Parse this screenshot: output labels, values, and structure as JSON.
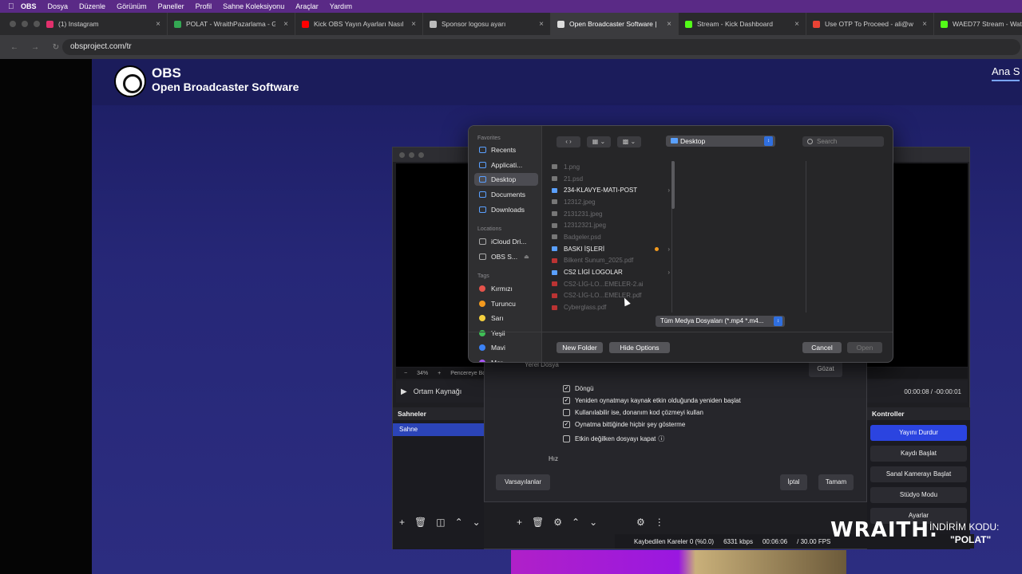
{
  "menubar": {
    "app": "OBS",
    "items": [
      "Dosya",
      "Düzenle",
      "Görünüm",
      "Paneller",
      "Profil",
      "Sahne Koleksiyonu",
      "Araçlar",
      "Yardım"
    ]
  },
  "tabs": [
    {
      "title": "(1) Instagram",
      "color": "#e1306c"
    },
    {
      "title": "POLAT - WraithPazarlama - G",
      "color": "#34a853"
    },
    {
      "title": "Kick OBS Yayın Ayarları Nasıl",
      "color": "#ff0000"
    },
    {
      "title": "Sponsor logosu ayarı",
      "color": "#bbbbbb"
    },
    {
      "title": "Open Broadcaster Software |",
      "color": "#dddddd"
    },
    {
      "title": "Stream - Kick Dashboard",
      "color": "#53fc18"
    },
    {
      "title": "Use OTP To Proceed - ali@w",
      "color": "#ea4335"
    },
    {
      "title": "WAED77 Stream - Watc",
      "color": "#53fc18"
    }
  ],
  "address": {
    "url": "obsproject.com/tr"
  },
  "site": {
    "brand_title": "OBS",
    "brand_subtitle": "Open Broadcaster Software",
    "nav": "Ana S"
  },
  "obs": {
    "zoom": "34%",
    "fit_label": "Pencereye Boy",
    "source_name": "Ortam Kaynağı",
    "time": "00:00:08  /  -00:00:01",
    "scenes_header": "Sahneler",
    "scene": "Sahne",
    "controls_header": "Kontroller",
    "controls": [
      "Yayını Durdur",
      "Kaydı Başlat",
      "Sanal Kamerayı Başlat",
      "Stüdyo Modu",
      "Ayarlar"
    ],
    "status": {
      "dropped": "Kaybedilen Kareler 0 (%0.0)",
      "bitrate": "6331 kbps",
      "elapsed": "00:06:06",
      "fps": "/ 30.00 FPS"
    }
  },
  "props": {
    "local_file_label": "Yerel Dosya",
    "browse": "Gözat",
    "checks": [
      {
        "label": "Döngü",
        "checked": true
      },
      {
        "label": "Yeniden oynatmayı kaynak etkin olduğunda yeniden başlat",
        "checked": true
      },
      {
        "label": "Kullanılabilir ise, donanım kod çözmeyi kullan",
        "checked": false
      },
      {
        "label": "Oynatma bittiğinde hiçbir şey gösterme",
        "checked": true
      },
      {
        "label": "Etkin değilken dosyayı kapat",
        "checked": false
      }
    ],
    "speed_label": "Hız",
    "defaults": "Varsayılanlar",
    "cancel": "İptal",
    "ok": "Tamam"
  },
  "dialog": {
    "location": "Desktop",
    "search_placeholder": "Search",
    "sections": {
      "favorites": "Favorites",
      "locations": "Locations",
      "tags": "Tags"
    },
    "favorites": [
      "Recents",
      "Applicati...",
      "Desktop",
      "Documents",
      "Downloads"
    ],
    "locations": [
      "iCloud Dri...",
      "OBS S..."
    ],
    "tags": [
      {
        "name": "Kırmızı",
        "color": "#e5534b"
      },
      {
        "name": "Turuncu",
        "color": "#f39a1e"
      },
      {
        "name": "Sarı",
        "color": "#f4d03f"
      },
      {
        "name": "Yeşil",
        "color": "#3fbf56"
      },
      {
        "name": "Mavi",
        "color": "#3b82f6"
      },
      {
        "name": "Mor",
        "color": "#a855f7"
      }
    ],
    "files": [
      {
        "name": "1.png",
        "kind": "img",
        "dim": true
      },
      {
        "name": "21.psd",
        "kind": "img",
        "dim": true
      },
      {
        "name": "234-KLAVYE-MATI-POST",
        "kind": "folder",
        "dim": false
      },
      {
        "name": "12312.jpeg",
        "kind": "img",
        "dim": true
      },
      {
        "name": "2131231.jpeg",
        "kind": "img",
        "dim": true
      },
      {
        "name": "12312321.jpeg",
        "kind": "img",
        "dim": true
      },
      {
        "name": "Badgeler.psd",
        "kind": "img",
        "dim": true
      },
      {
        "name": "BASKI İŞLERİ",
        "kind": "folder",
        "dim": false
      },
      {
        "name": "Bilkent Sunum_2025.pdf",
        "kind": "pdf",
        "dim": true
      },
      {
        "name": "CS2 LİGİ LOGOLAR",
        "kind": "folder",
        "dim": false
      },
      {
        "name": "CS2-LİG-LO...EMELER-2.ai",
        "kind": "pdf",
        "dim": true
      },
      {
        "name": "CS2-LİG-LO...EMELER.pdf",
        "kind": "pdf",
        "dim": true
      },
      {
        "name": "Cyberglass.pdf",
        "kind": "pdf",
        "dim": true
      }
    ],
    "file_type": "Tüm Medya Dosyaları (*.mp4 *.m4...",
    "new_folder": "New Folder",
    "hide_options": "Hide Options",
    "cancel": "Cancel",
    "open": "Open"
  },
  "promo": {
    "brand": "WRAITH.",
    "line1": "İNDİRİM KODU:",
    "line2": "\"POLAT\""
  }
}
